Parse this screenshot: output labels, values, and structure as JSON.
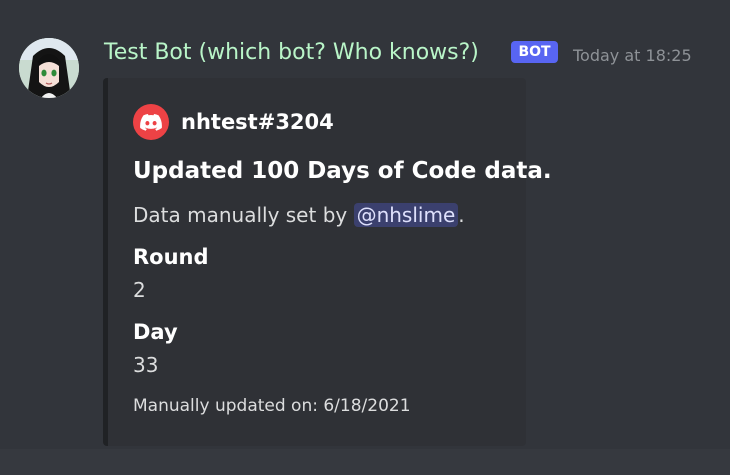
{
  "message": {
    "author": "Test Bot (which bot? Who knows?)",
    "bot_tag": "BOT",
    "timestamp": "Today at 18:25",
    "avatar_icon": "anime-avatar",
    "embed": {
      "author_name": "nhtest#3204",
      "author_icon": "discord-logo-icon",
      "author_icon_color": "#ed4245",
      "title": "Updated 100 Days of Code data.",
      "description_prefix": "Data manually set by ",
      "mention": "@nhslime",
      "description_suffix": ".",
      "fields": [
        {
          "name": "Round",
          "value": "2"
        },
        {
          "name": "Day",
          "value": "33"
        }
      ],
      "footer": "Manually updated on: 6/18/2021"
    }
  },
  "colors": {
    "background": "#36393f",
    "message_hover": "#32353b",
    "username": "#b9f5c8",
    "bot_tag": "#5865f2",
    "embed_background": "#2f3136",
    "embed_border": "#202225"
  }
}
